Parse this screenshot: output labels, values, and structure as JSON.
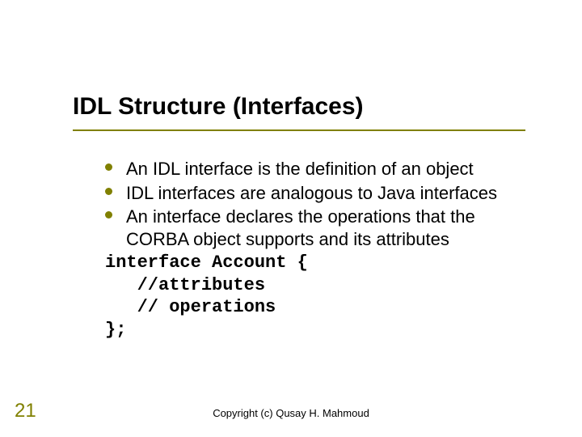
{
  "slide": {
    "title": "IDL Structure (Interfaces)",
    "bullets": [
      "An IDL interface is the definition of an object",
      "IDL interfaces are analogous to Java interfaces",
      "An interface declares the operations that the CORBA object supports and its attributes"
    ],
    "code": [
      "interface Account {",
      "   //attributes",
      "   // operations",
      "};"
    ],
    "page_number": "21",
    "copyright": "Copyright (c) Qusay H. Mahmoud"
  }
}
